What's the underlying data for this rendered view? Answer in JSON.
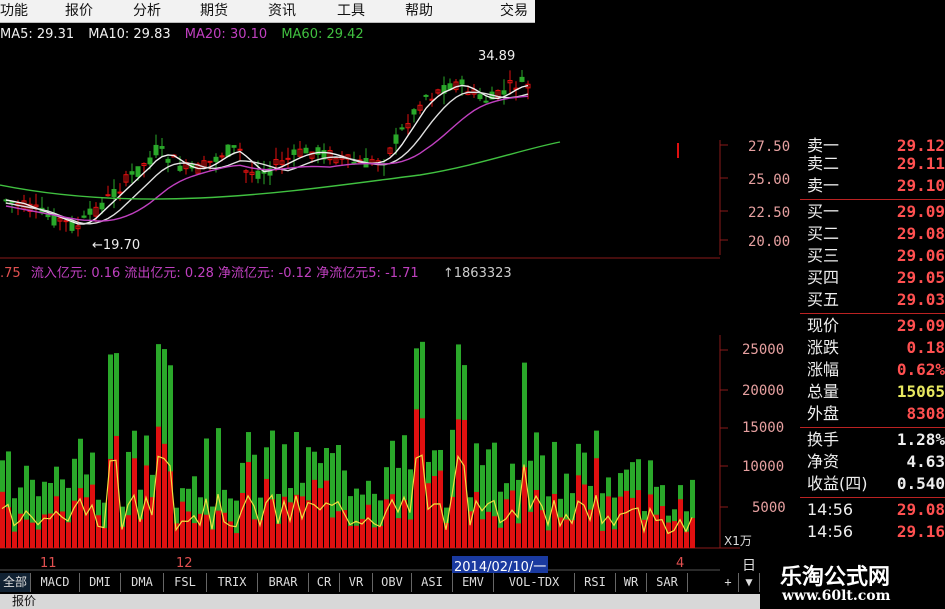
{
  "menu": [
    "功能",
    "报价",
    "分析",
    "期货",
    "资讯",
    "工具",
    "帮助",
    "交易"
  ],
  "ma": [
    {
      "label": "MA5: 29.31",
      "color": "#f0f0f0"
    },
    {
      "label": "MA10: 29.83",
      "color": "#f0f0f0"
    },
    {
      "label": "MA20: 30.10",
      "color": "#c040c0"
    },
    {
      "label": "MA60: 29.42",
      "color": "#40c040"
    }
  ],
  "price_chart": {
    "high_label": "34.89",
    "low_label": "19.70",
    "y_ticks": [
      "27.50",
      "25.00",
      "22.50",
      "20.00"
    ]
  },
  "flow_line": {
    "prefix": ".75",
    "text": "流入亿元: 0.16 流出亿元: 0.28 净流亿元: -0.12 净流亿元5: -1.71",
    "tail": "↑1863323"
  },
  "volume_chart": {
    "y_ticks": [
      "25000",
      "20000",
      "15000",
      "10000",
      "5000"
    ],
    "unit": "X1万",
    "x_labels": [
      "11",
      "12",
      "2014/02/10/一",
      "4"
    ]
  },
  "quote": {
    "sell": [
      {
        "label": "卖一",
        "value": "29.12"
      },
      {
        "label": "卖二",
        "value": "29.11"
      },
      {
        "label": "卖一",
        "value": "29.10"
      }
    ],
    "buy": [
      {
        "label": "买一",
        "value": "29.09"
      },
      {
        "label": "买二",
        "value": "29.08"
      },
      {
        "label": "买三",
        "value": "29.06"
      },
      {
        "label": "买四",
        "value": "29.05"
      },
      {
        "label": "买五",
        "value": "29.03"
      }
    ],
    "stats": [
      {
        "label": "现价",
        "value": "29.09",
        "color": "#ff5050"
      },
      {
        "label": "涨跌",
        "value": "0.18",
        "color": "#ff5050"
      },
      {
        "label": "涨幅",
        "value": "0.62%",
        "color": "#ff5050"
      },
      {
        "label": "总量",
        "value": "15065",
        "color": "#e8e860"
      },
      {
        "label": "外盘",
        "value": "8308",
        "color": "#ff5050"
      }
    ],
    "extra": [
      {
        "label": "换手",
        "value": "1.28%",
        "color": "#eeeeee"
      },
      {
        "label": "净资",
        "value": "4.63",
        "color": "#eeeeee"
      },
      {
        "label": "收益(四)",
        "value": "0.540",
        "color": "#eeeeee"
      }
    ],
    "ticks": [
      {
        "label": "14:56",
        "value": "29.08",
        "color": "#ff5050"
      },
      {
        "label": "14:56",
        "value": "29.16",
        "color": "#ff5050"
      }
    ],
    "side_label": "日"
  },
  "tabs": [
    "全部",
    "MACD",
    "DMI",
    "DMA",
    "FSL",
    "TRIX",
    "BRAR",
    "CR",
    "VR",
    "OBV",
    "ASI",
    "EMV",
    "VOL-TDX",
    "RSI",
    "WR",
    "SAR",
    "+",
    "▼"
  ],
  "status_text": "报价",
  "watermark": {
    "title": "乐淘公式网",
    "url": "www.60lt.com"
  },
  "colors": {
    "up": "#e01010",
    "down": "#2aa82a",
    "grid": "#8a1a1a"
  }
}
